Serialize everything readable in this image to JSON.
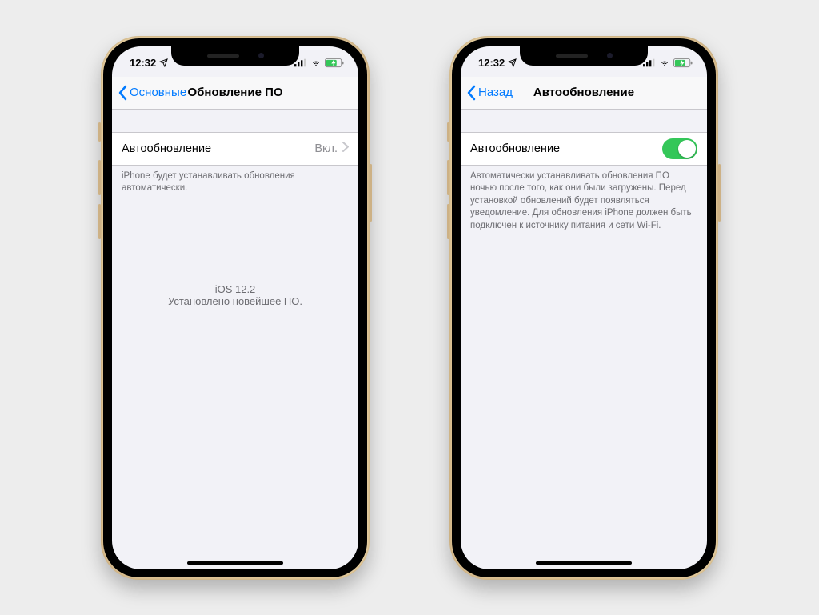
{
  "colors": {
    "accent": "#007aff",
    "toggleOn": "#34c759",
    "background": "#f2f2f7"
  },
  "statusbar": {
    "time": "12:32",
    "locationIcon": "location-arrow",
    "signalIcon": "cellular-signal",
    "wifiIcon": "wifi",
    "batteryIcon": "battery-charging"
  },
  "phone1": {
    "nav": {
      "back": "Основные",
      "title": "Обновление ПО"
    },
    "autoUpdate": {
      "label": "Автообновление",
      "value": "Вкл."
    },
    "footer": "iPhone будет устанавливать обновления автоматически.",
    "center": {
      "version": "iOS 12.2",
      "message": "Установлено новейшее ПО."
    }
  },
  "phone2": {
    "nav": {
      "back": "Назад",
      "title": "Автообновление"
    },
    "toggleRow": {
      "label": "Автообновление",
      "on": true
    },
    "footer": "Автоматически устанавливать обновления ПО ночью после того, как они были загружены. Перед установкой обновлений будет появляться уведомление. Для обновления iPhone должен быть подключен к источнику питания и сети Wi-Fi."
  }
}
